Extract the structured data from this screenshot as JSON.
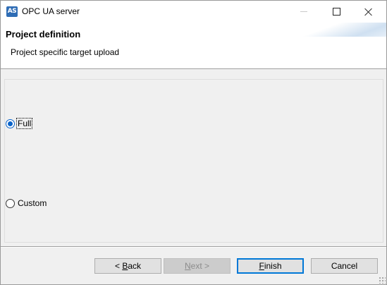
{
  "window": {
    "icon_text": "AS",
    "title": "OPC UA server"
  },
  "header": {
    "title": "Project definition",
    "description": "Project specific target upload"
  },
  "options": {
    "full": {
      "label": "Full",
      "checked": true
    },
    "custom": {
      "label": "Custom",
      "checked": false
    }
  },
  "buttons": {
    "back": {
      "prefix": "< ",
      "mnemonic": "B",
      "rest": "ack"
    },
    "next": {
      "mnemonic": "N",
      "rest": "ext >",
      "enabled": false
    },
    "finish": {
      "mnemonic": "F",
      "rest": "inish"
    },
    "cancel": {
      "label": "Cancel"
    }
  },
  "colors": {
    "accent": "#0078d7",
    "radio_selected": "#0a63c9",
    "app_icon": "#2f6db5"
  }
}
